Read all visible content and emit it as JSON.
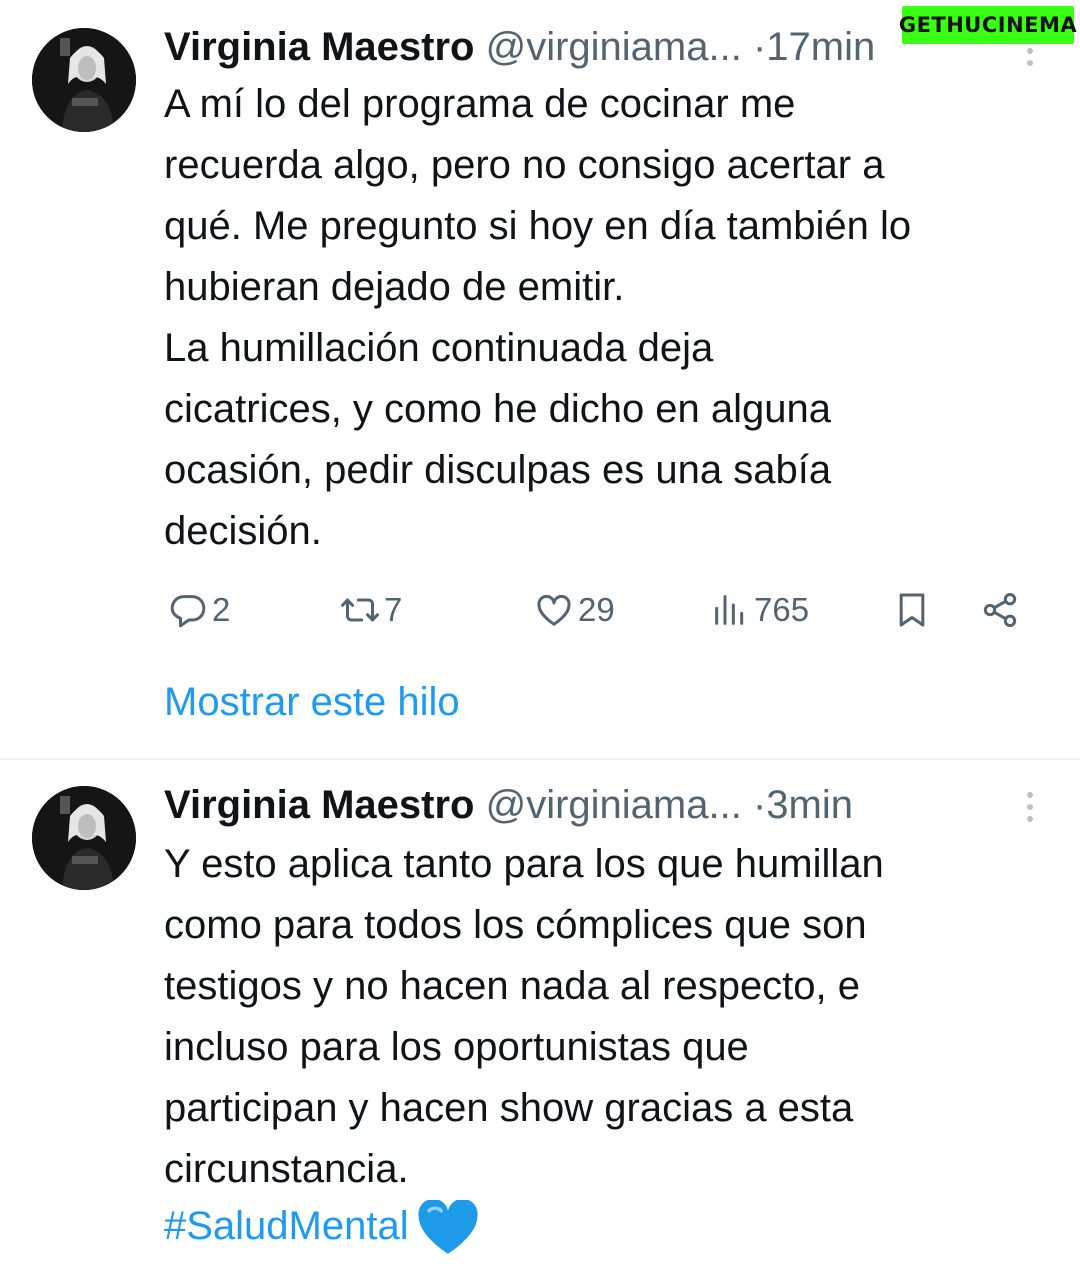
{
  "watermark": {
    "part1": "GETHU",
    "part2": "CINEMA"
  },
  "tweets": [
    {
      "display_name": "Virginia Maestro",
      "handle": "@virginiama...",
      "separator": "·",
      "time": "17min",
      "text": "A mí lo del programa de cocinar me\nrecuerda algo, pero no consigo acertar a\nqué. Me pregunto si hoy en día también lo\nhubieran dejado de emitir.\nLa humillación continuada deja\ncicatrices, y como he dicho en alguna\nocasión, pedir disculpas es una sabía\ndecisión.",
      "actions": {
        "replies": "2",
        "retweets": "7",
        "likes": "29",
        "views": "765"
      },
      "show_thread": "Mostrar este hilo"
    },
    {
      "display_name": "Virginia Maestro",
      "handle": "@virginiama...",
      "separator": "·",
      "time": "3min",
      "text": "Y esto aplica tanto para los que humillan\ncomo para todos los cómplices que son\ntestigos y no hacen nada al respecto, e\nincluso para los oportunistas que\nparticipan y hacen show gracias a esta\ncircunstancia.",
      "hashtag": "#SaludMental",
      "emoji": "blue-heart"
    }
  ],
  "colors": {
    "link": "#1d9bf0",
    "secondary": "#536471",
    "text": "#0f1419"
  }
}
